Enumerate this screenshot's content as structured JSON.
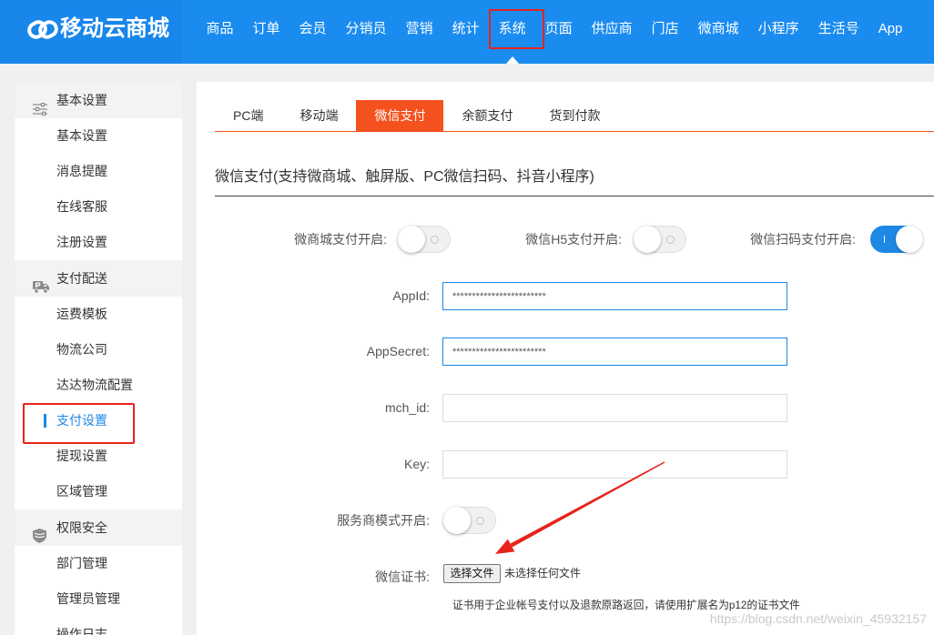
{
  "colors": {
    "header_bg": "#1a8cf0",
    "logo_bg": "#1886ea",
    "accent_blue": "#1e88e5",
    "tab_active": "#f5511e",
    "annotation_red": "#e8231c"
  },
  "brand": {
    "name": "移动云商城",
    "icon": "chain-link-logo-icon"
  },
  "topnav": {
    "items": [
      {
        "label": "商品"
      },
      {
        "label": "订单"
      },
      {
        "label": "会员"
      },
      {
        "label": "分销员"
      },
      {
        "label": "营销"
      },
      {
        "label": "统计"
      },
      {
        "label": "系统",
        "active": true
      },
      {
        "label": "页面"
      },
      {
        "label": "供应商"
      },
      {
        "label": "门店"
      },
      {
        "label": "微商城"
      },
      {
        "label": "小程序"
      },
      {
        "label": "生活号"
      },
      {
        "label": "App"
      }
    ]
  },
  "sidebar": {
    "groups": [
      {
        "label": "基本设置",
        "icon": "sliders-icon",
        "items": [
          {
            "label": "基本设置"
          },
          {
            "label": "消息提醒"
          },
          {
            "label": "在线客服"
          },
          {
            "label": "注册设置"
          }
        ]
      },
      {
        "label": "支付配送",
        "icon": "delivery-truck-icon",
        "items": [
          {
            "label": "运费模板"
          },
          {
            "label": "物流公司"
          },
          {
            "label": "达达物流配置"
          },
          {
            "label": "支付设置",
            "active": true
          },
          {
            "label": "提现设置"
          },
          {
            "label": "区域管理"
          }
        ]
      },
      {
        "label": "权限安全",
        "icon": "shield-icon",
        "items": [
          {
            "label": "部门管理"
          },
          {
            "label": "管理员管理"
          },
          {
            "label": "操作日志"
          }
        ]
      }
    ]
  },
  "tabs": [
    {
      "label": "PC端"
    },
    {
      "label": "移动端"
    },
    {
      "label": "微信支付",
      "active": true
    },
    {
      "label": "余额支付"
    },
    {
      "label": "货到付款"
    }
  ],
  "section_title": "微信支付(支持微商城、触屏版、PC微信扫码、抖音小程序)",
  "switches": [
    {
      "label": "微商城支付开启:",
      "on": false
    },
    {
      "label": "微信H5支付开启:",
      "on": false
    },
    {
      "label": "微信扫码支付开启:",
      "on": true
    }
  ],
  "fields": {
    "appid": {
      "label": "AppId:",
      "value": "************************"
    },
    "appsecret": {
      "label": "AppSecret:",
      "value": "************************"
    },
    "mch_id": {
      "label": "mch_id:",
      "value": ""
    },
    "key": {
      "label": "Key:",
      "value": ""
    }
  },
  "provider_mode": {
    "label": "服务商模式开启:",
    "on": false
  },
  "certificate": {
    "label": "微信证书:",
    "button_label": "选择文件",
    "status": "未选择任何文件",
    "help": "证书用于企业帐号支付以及退款原路返回，请使用扩展名为p12的证书文件"
  },
  "watermark": "https://blog.csdn.net/weixin_45932157"
}
